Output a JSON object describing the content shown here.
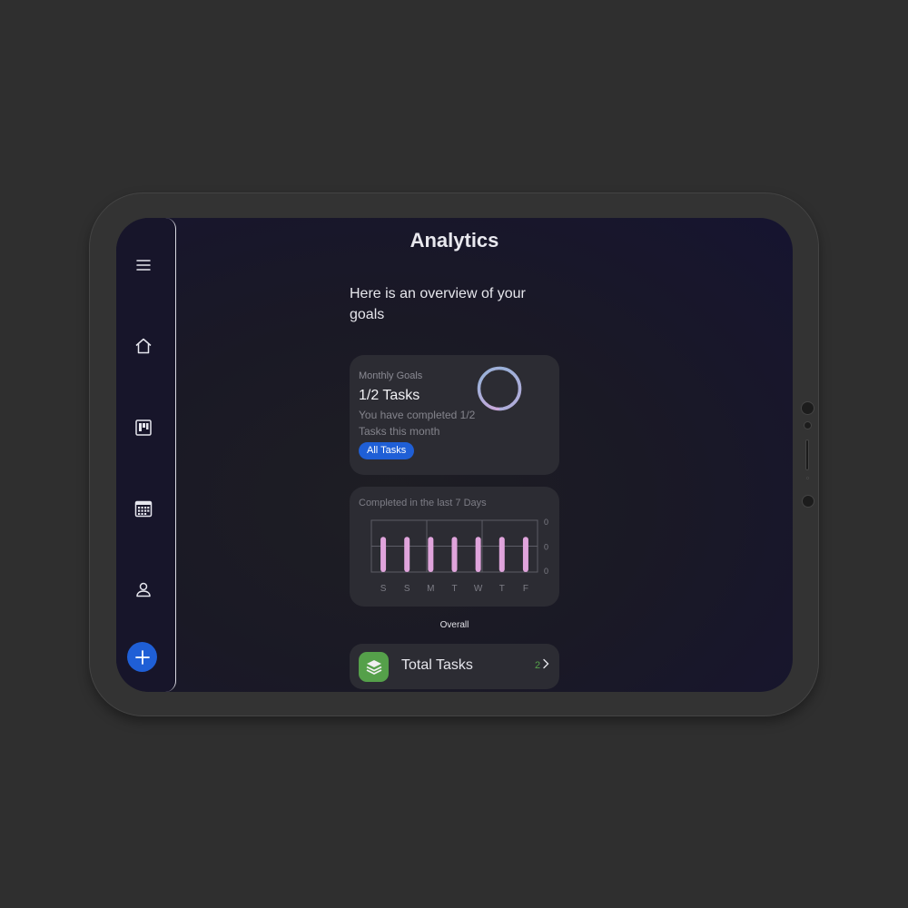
{
  "page": {
    "title": "Analytics",
    "intro": "Here is an overview of your goals"
  },
  "sidebar": {
    "items": [
      {
        "name": "menu",
        "icon": "hamburger-menu-icon"
      },
      {
        "name": "home",
        "icon": "home-icon"
      },
      {
        "name": "board",
        "icon": "kanban-board-icon"
      },
      {
        "name": "calendar",
        "icon": "calendar-icon"
      },
      {
        "name": "profile",
        "icon": "user-icon"
      }
    ],
    "fab_icon": "plus-icon"
  },
  "monthly_goals": {
    "label": "Monthly Goals",
    "value": "1/2 Tasks",
    "description": "You have completed 1/2 Tasks this month",
    "button": "All Tasks",
    "progress": 0.5
  },
  "chart_data": {
    "type": "bar",
    "title": "Completed in the last 7 Days",
    "categories": [
      "S",
      "S",
      "M",
      "T",
      "W",
      "T",
      "F"
    ],
    "values": [
      0,
      0,
      0,
      0,
      0,
      0,
      0
    ],
    "y_tick_labels": [
      "0",
      "0",
      "0"
    ],
    "grid": true,
    "bar_color": "#e0a4dc"
  },
  "overall_label": "Overall",
  "total_tasks": {
    "label": "Total Tasks",
    "count": "2",
    "icon": "layers-icon"
  },
  "colors": {
    "accent": "#1f5fd6",
    "success": "#55a04a",
    "card": "#2c2c33"
  }
}
